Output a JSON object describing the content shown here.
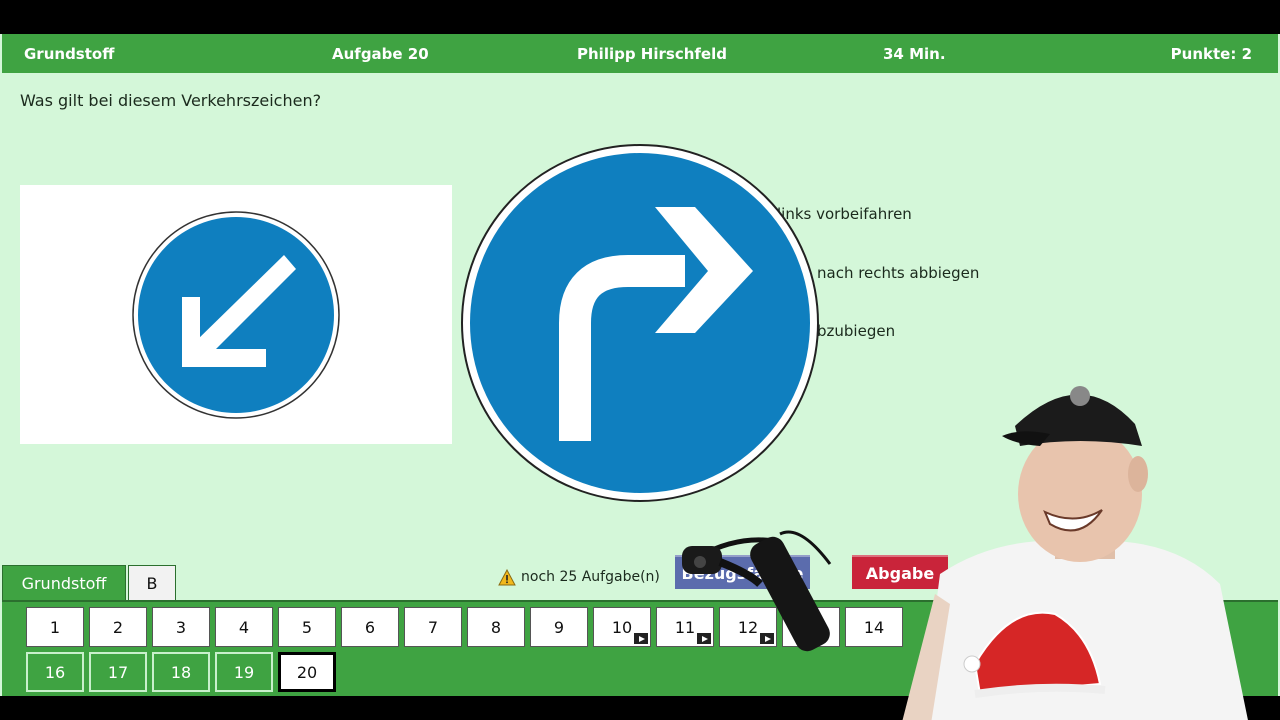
{
  "header": {
    "section": "Grundstoff",
    "task": "Aufgabe 20",
    "user": "Philipp Hirschfeld",
    "time": "34 Min.",
    "points": "Punkte: 2"
  },
  "question": "Was gilt bei diesem Verkehrszeichen?",
  "answers": [
    "links vorbeifahren",
    "nach rechts abbiegen",
    "bzubiegen"
  ],
  "signs": {
    "question_sign": "keep-left-arrow-sign",
    "overlay_sign": "turn-right-arrow-sign",
    "sign_blue": "#0f7fbf"
  },
  "tabs": {
    "active": "Grundstoff",
    "other": "B"
  },
  "remaining": "noch 25 Aufgabe(n)",
  "buttons": {
    "reference": "Bezugsfahrze",
    "submit": "Abgabe"
  },
  "tasks_row1": [
    {
      "n": "1"
    },
    {
      "n": "2"
    },
    {
      "n": "3"
    },
    {
      "n": "4"
    },
    {
      "n": "5"
    },
    {
      "n": "6"
    },
    {
      "n": "7"
    },
    {
      "n": "8"
    },
    {
      "n": "9"
    },
    {
      "n": "10",
      "video": true
    },
    {
      "n": "11",
      "video": true
    },
    {
      "n": "12",
      "video": true
    },
    {
      "n": "13"
    },
    {
      "n": "14"
    }
  ],
  "tasks_row2": [
    {
      "n": "16"
    },
    {
      "n": "17"
    },
    {
      "n": "18"
    },
    {
      "n": "19"
    },
    {
      "n": "20",
      "current": true
    }
  ],
  "colors": {
    "header_green": "#3fa342",
    "bg_green": "#d4f7d9",
    "submit_red": "#c9243a",
    "ref_blue": "#5b6cad"
  }
}
